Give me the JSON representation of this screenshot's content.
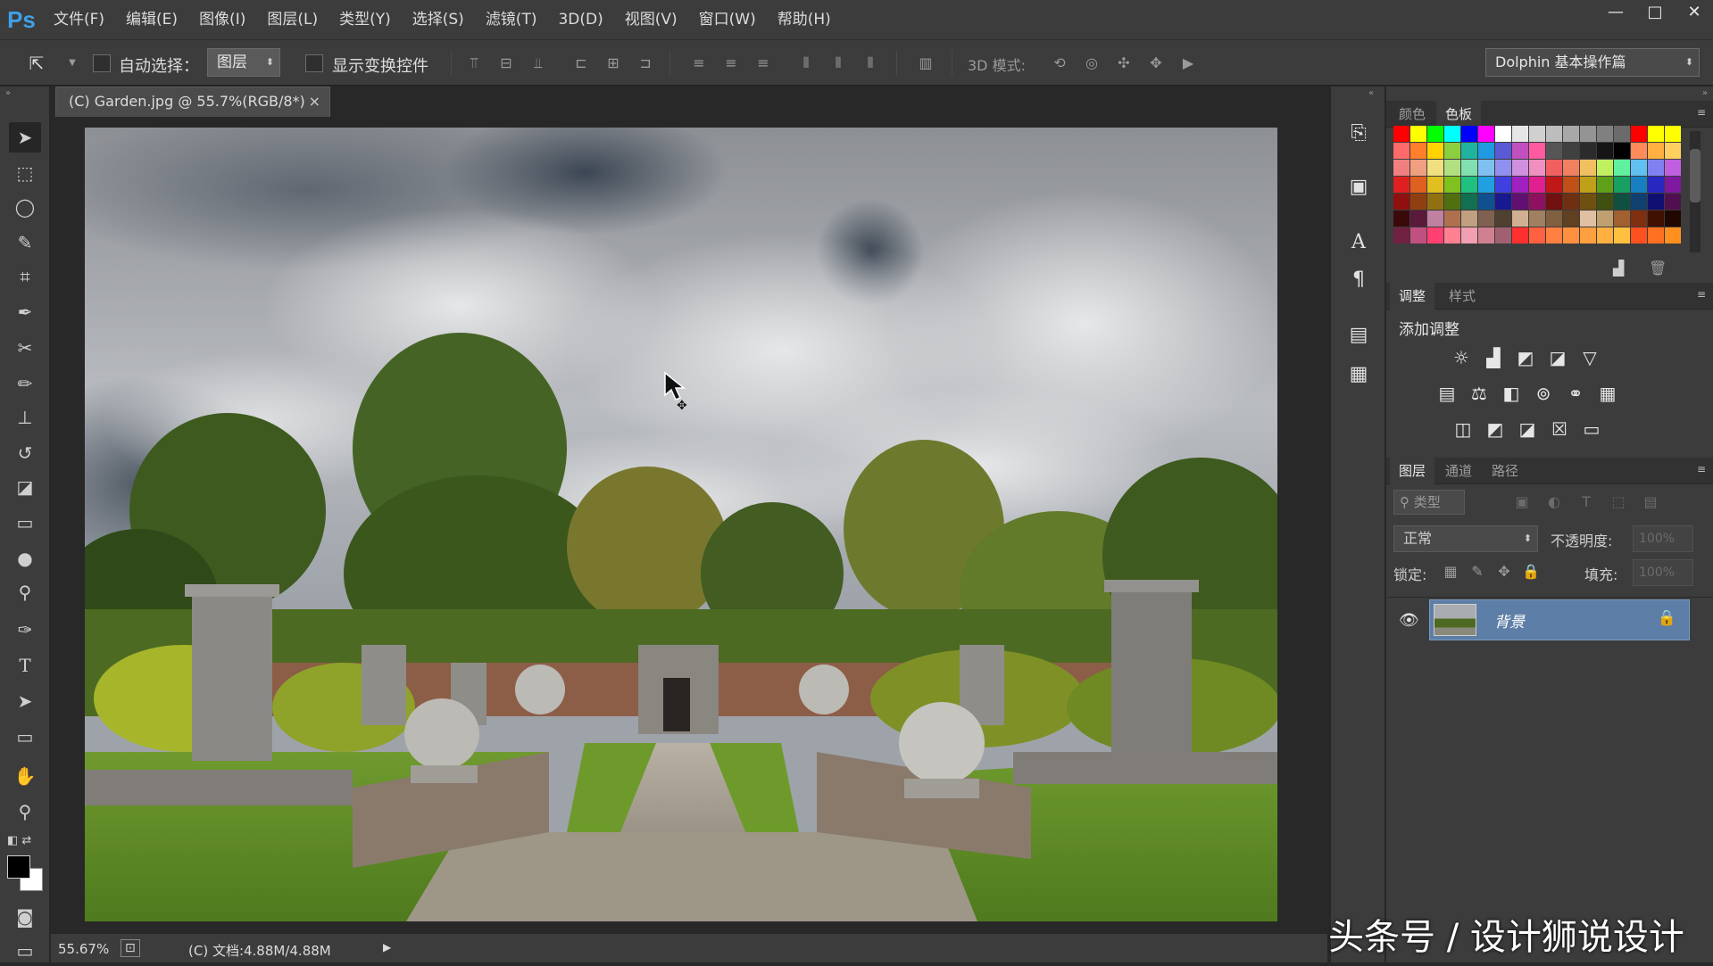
{
  "menubar": {
    "logo": "Ps",
    "items": [
      "文件(F)",
      "编辑(E)",
      "图像(I)",
      "图层(L)",
      "类型(Y)",
      "选择(S)",
      "滤镜(T)",
      "3D(D)",
      "视图(V)",
      "窗口(W)",
      "帮助(H)"
    ],
    "window_buttons": {
      "minimize": "—",
      "maximize": "□",
      "close": "✕"
    }
  },
  "options": {
    "auto_select_label": "自动选择：",
    "auto_select_value": "图层",
    "show_transform_label": "显示变换控件",
    "mode_3d_label": "3D 模式:",
    "workspace": "Dolphin 基本操作篇"
  },
  "document": {
    "tab_title": "(C) Garden.jpg @ 55.7%(RGB/8*)",
    "close": "×"
  },
  "status": {
    "zoom": "55.67%",
    "doc_info": "(C) 文档:4.88M/4.88M",
    "arrow": "▶"
  },
  "panels": {
    "color_tabs": [
      "颜色",
      "色板"
    ],
    "adjust_tabs": [
      "调整",
      "样式"
    ],
    "add_adjustment": "添加调整",
    "layers_tabs": [
      "图层",
      "通道",
      "路径"
    ],
    "filter_kind": "类型",
    "blend_mode": "正常",
    "opacity_label": "不透明度:",
    "opacity_value": "100%",
    "lock_label": "锁定:",
    "fill_label": "填充:",
    "fill_value": "100%",
    "layer_name": "背景"
  },
  "watermark": "头条号 / 设计狮说设计",
  "colors": {
    "ui_dark": "#3c3c3c",
    "canvas_bg": "#282828",
    "layer_selected": "#5d7ea6",
    "ps_blue": "#3ea0e8"
  }
}
